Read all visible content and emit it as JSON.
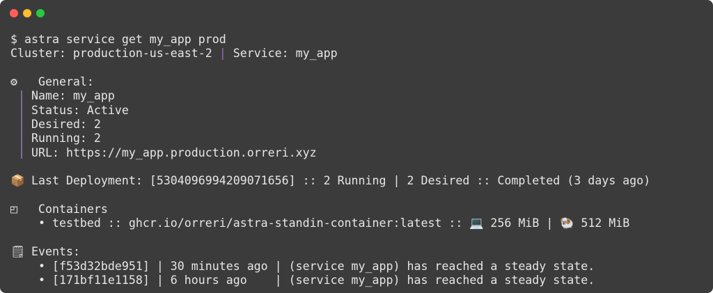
{
  "window": {
    "controls": {
      "close_color": "#ff5f57",
      "minimize_color": "#febc2e",
      "maximize_color": "#28c840"
    }
  },
  "command": "$ astra service get my_app prod",
  "cluster_line": {
    "cluster": "Cluster: production-us-east-2",
    "separator": "|",
    "service": "Service: my_app"
  },
  "general": {
    "icon": "⚙",
    "title": "General:",
    "fields": [
      "Name: my_app",
      "Status: Active",
      "Desired: 2",
      "Running: 2",
      "URL: https://my_app.production.orreri.xyz"
    ]
  },
  "deployment": {
    "icon": "📦",
    "text": "Last Deployment: [5304096994209071656] :: 2 Running | 2 Desired :: Completed (3 days ago)"
  },
  "containers": {
    "icon": "◰",
    "title": "Containers",
    "items": [
      {
        "bullet": "•",
        "text": "testbed :: ghcr.io/orreri/astra-standin-container:latest ::",
        "cpu_icon": "💻",
        "cpu": "256 MiB |",
        "mem_icon": "🐏",
        "mem": "512 MiB"
      }
    ]
  },
  "events": {
    "icon": "🗒",
    "title": "Events:",
    "items": [
      {
        "bullet": "•",
        "text": "[f53d32bde951] | 30 minutes ago | (service my_app) has reached a steady state."
      },
      {
        "bullet": "•",
        "text": "[171bf11e1158] | 6 hours ago    | (service my_app) has reached a steady state."
      }
    ]
  }
}
